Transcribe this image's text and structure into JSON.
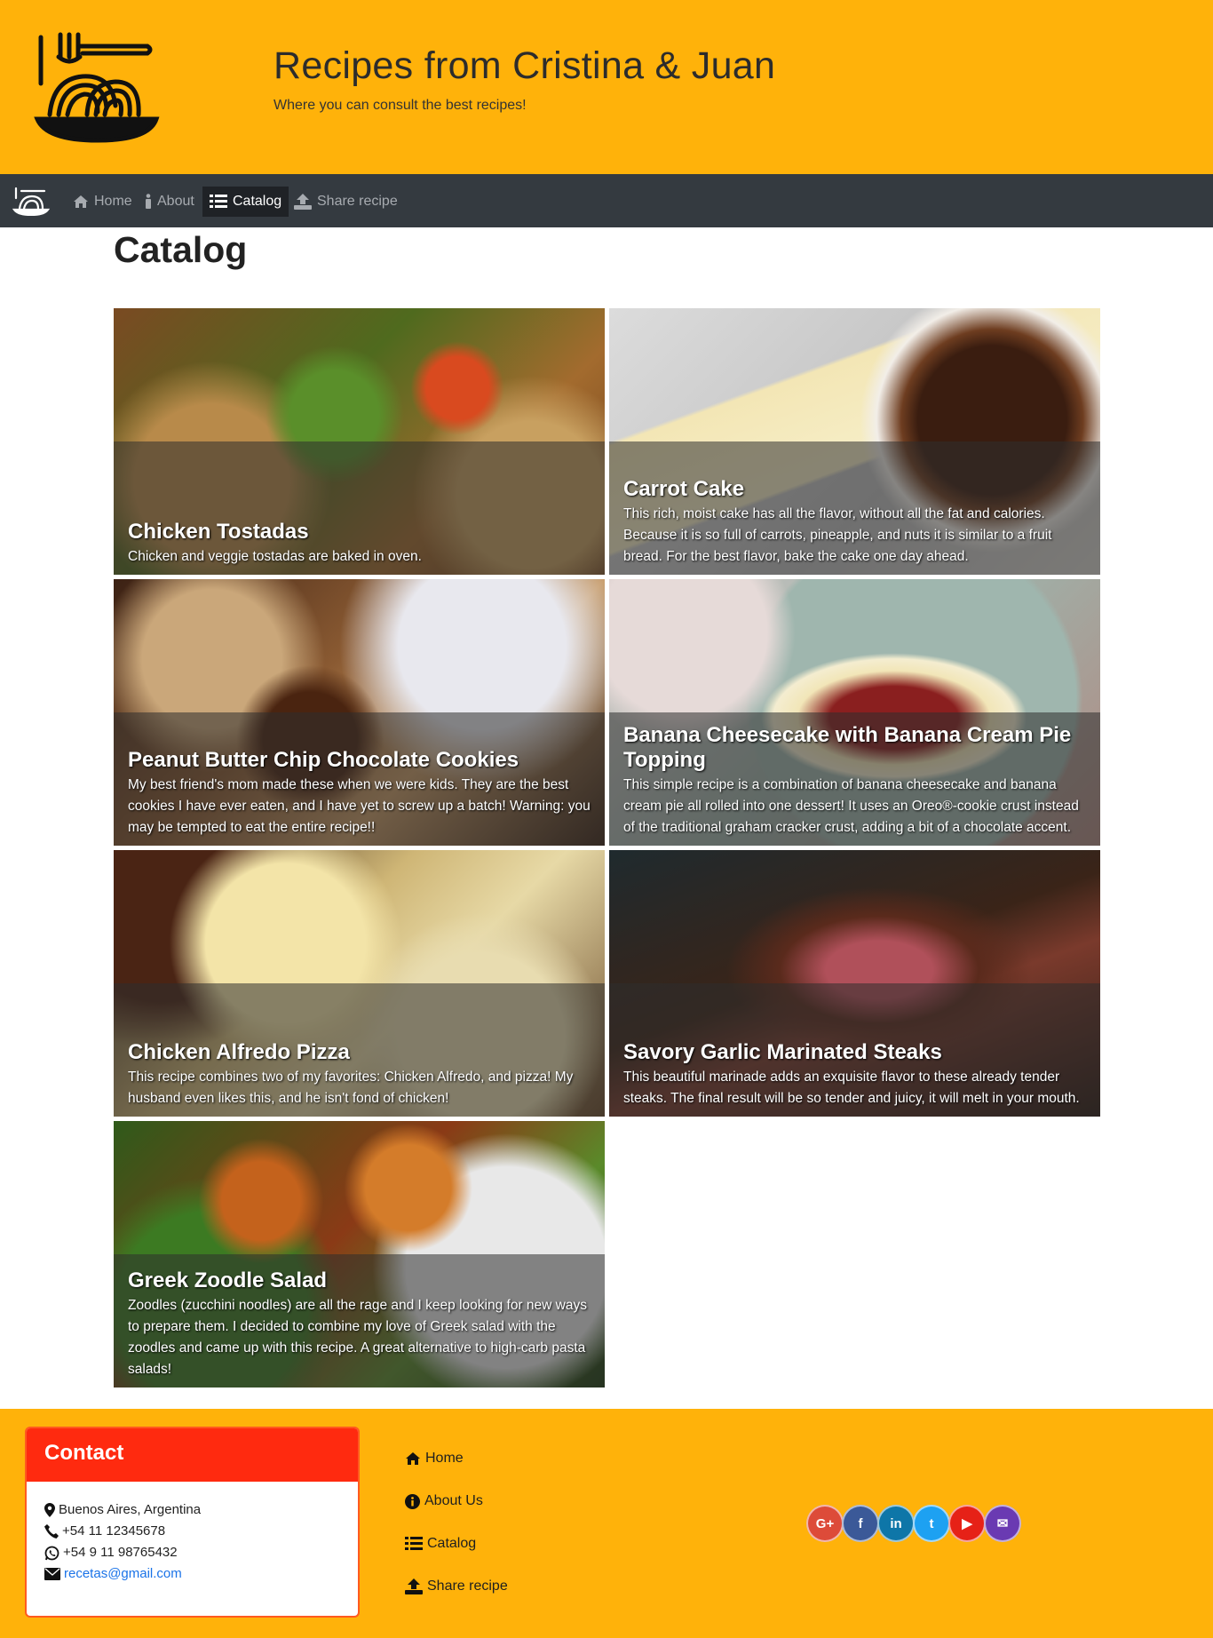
{
  "header": {
    "title": "Recipes from Cristina & Juan",
    "subtitle": "Where you can consult the best recipes!"
  },
  "nav": {
    "items": [
      {
        "label": "Home",
        "icon": "home-icon"
      },
      {
        "label": "About",
        "icon": "info-icon"
      },
      {
        "label": "Catalog",
        "icon": "list-icon",
        "active": true
      },
      {
        "label": "Share recipe",
        "icon": "upload-icon"
      }
    ]
  },
  "catalog": {
    "title": "Catalog",
    "cards": [
      {
        "title": "Chicken Tostadas",
        "description": "Chicken and veggie tostadas are baked in oven."
      },
      {
        "title": "Carrot Cake",
        "description": "This rich, moist cake has all the flavor, without all the fat and calories. Because it is so full of carrots, pineapple, and nuts it is similar to a fruit bread. For the best flavor, bake the cake one day ahead."
      },
      {
        "title": "Peanut Butter Chip Chocolate Cookies",
        "description": "My best friend's mom made these when we were kids. They are the best cookies I have ever eaten, and I have yet to screw up a batch! Warning: you may be tempted to eat the entire recipe!!"
      },
      {
        "title": "Banana Cheesecake with Banana Cream Pie Topping",
        "description": "This simple recipe is a combination of banana cheesecake and banana cream pie all rolled into one dessert! It uses an Oreo®-cookie crust instead of the traditional graham cracker crust, adding a bit of a chocolate accent."
      },
      {
        "title": "Chicken Alfredo Pizza",
        "description": "This recipe combines two of my favorites: Chicken Alfredo, and pizza! My husband even likes this, and he isn't fond of chicken!"
      },
      {
        "title": "Savory Garlic Marinated Steaks",
        "description": "This beautiful marinade adds an exquisite flavor to these already tender steaks. The final result will be so tender and juicy, it will melt in your mouth."
      },
      {
        "title": "Greek Zoodle Salad",
        "description": "Zoodles (zucchini noodles) are all the rage and I keep looking for new ways to prepare them. I decided to combine my love of Greek salad with the zoodles and came up with this recipe. A great alternative to high-carb pasta salads!"
      }
    ]
  },
  "footer": {
    "contact": {
      "heading": "Contact",
      "address": "Buenos Aires, Argentina",
      "phone": "+54 11 12345678",
      "whatsapp": "+54 9 11 98765432",
      "email": "recetas@gmail.com"
    },
    "links": [
      {
        "label": "Home",
        "icon": "home-icon"
      },
      {
        "label": "About Us",
        "icon": "info-circle-icon"
      },
      {
        "label": "Catalog",
        "icon": "list-icon"
      },
      {
        "label": "Share recipe",
        "icon": "upload-icon"
      }
    ],
    "social": [
      {
        "name": "google-plus",
        "glyph": "G+",
        "color": "#dd4b39"
      },
      {
        "name": "facebook",
        "glyph": "f",
        "color": "#3b5998"
      },
      {
        "name": "linkedin",
        "glyph": "in",
        "color": "#0e76a8"
      },
      {
        "name": "twitter",
        "glyph": "t",
        "color": "#1da1f2"
      },
      {
        "name": "youtube",
        "glyph": "▶",
        "color": "#e62117"
      },
      {
        "name": "email",
        "glyph": "✉",
        "color": "#6a3ab2"
      }
    ]
  },
  "colors": {
    "accent": "#FFB20A",
    "navbar": "#343a40",
    "contact_header": "#ff2a0f"
  }
}
